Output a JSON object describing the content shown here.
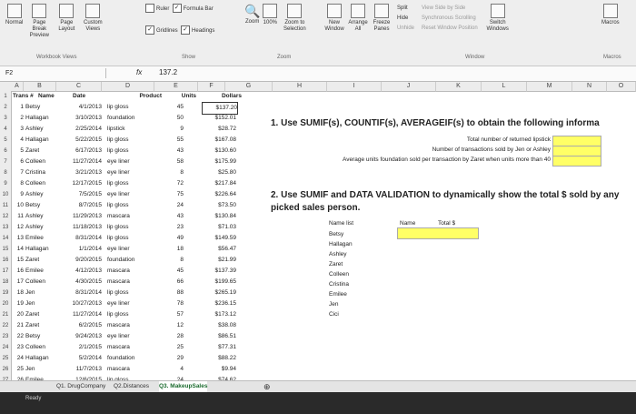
{
  "ribbon": {
    "workbook_views": [
      "Normal",
      "Page Break Preview",
      "Page Layout",
      "Custom Views"
    ],
    "show": {
      "ruler": "Ruler",
      "formula_bar": "Formula Bar",
      "gridlines": "Gridlines",
      "headings": "Headings"
    },
    "zoom": [
      "Zoom",
      "100%",
      "Zoom to Selection"
    ],
    "window": [
      "New Window",
      "Arrange All",
      "Freeze Panes",
      "Split",
      "Hide",
      "Unhide",
      "View Side by Side",
      "Synchronous Scrolling",
      "Reset Window Position",
      "Switch Windows"
    ],
    "macros": "Macros",
    "group_names": [
      "Workbook Views",
      "Show",
      "Zoom",
      "Window",
      "Macros"
    ]
  },
  "formula_bar": {
    "name_box": "F2",
    "fx": "fx",
    "value": "137.2"
  },
  "columns": [
    "A",
    "B",
    "C",
    "D",
    "E",
    "F",
    "G",
    "H",
    "I",
    "J",
    "K",
    "L",
    "M",
    "N",
    "O"
  ],
  "table": {
    "headers": [
      "Trans #",
      "Name",
      "Date",
      "Product",
      "Units",
      "Dollars"
    ],
    "rows": [
      [
        "1",
        "Betsy",
        "4/1/2013",
        "lip gloss",
        "45",
        "$137.20"
      ],
      [
        "2",
        "Hallagan",
        "3/10/2013",
        "foundation",
        "50",
        "$152.01"
      ],
      [
        "3",
        "Ashley",
        "2/25/2014",
        "lipstick",
        "9",
        "$28.72"
      ],
      [
        "4",
        "Hallagan",
        "5/22/2015",
        "lip gloss",
        "55",
        "$167.08"
      ],
      [
        "5",
        "Zaret",
        "6/17/2013",
        "lip gloss",
        "43",
        "$130.60"
      ],
      [
        "6",
        "Colleen",
        "11/27/2014",
        "eye liner",
        "58",
        "$175.99"
      ],
      [
        "7",
        "Cristina",
        "3/21/2013",
        "eye liner",
        "8",
        "$25.80"
      ],
      [
        "8",
        "Colleen",
        "12/17/2015",
        "lip gloss",
        "72",
        "$217.84"
      ],
      [
        "9",
        "Ashley",
        "7/5/2015",
        "eye liner",
        "75",
        "$226.64"
      ],
      [
        "10",
        "Betsy",
        "8/7/2015",
        "lip gloss",
        "24",
        "$73.50"
      ],
      [
        "11",
        "Ashley",
        "11/29/2013",
        "mascara",
        "43",
        "$130.84"
      ],
      [
        "12",
        "Ashley",
        "11/18/2013",
        "lip gloss",
        "23",
        "$71.03"
      ],
      [
        "13",
        "Emilee",
        "8/31/2014",
        "lip gloss",
        "49",
        "$149.59"
      ],
      [
        "14",
        "Hallagan",
        "1/1/2014",
        "eye liner",
        "18",
        "$56.47"
      ],
      [
        "15",
        "Zaret",
        "9/20/2015",
        "foundation",
        "8",
        "$21.99"
      ],
      [
        "16",
        "Emilee",
        "4/12/2013",
        "mascara",
        "45",
        "$137.39"
      ],
      [
        "17",
        "Colleen",
        "4/30/2015",
        "mascara",
        "66",
        "$199.65"
      ],
      [
        "18",
        "Jen",
        "8/31/2014",
        "lip gloss",
        "88",
        "$265.19"
      ],
      [
        "19",
        "Jen",
        "10/27/2013",
        "eye liner",
        "78",
        "$236.15"
      ],
      [
        "20",
        "Zaret",
        "11/27/2014",
        "lip gloss",
        "57",
        "$173.12"
      ],
      [
        "21",
        "Zaret",
        "6/2/2015",
        "mascara",
        "12",
        "$38.08"
      ],
      [
        "22",
        "Betsy",
        "9/24/2013",
        "eye liner",
        "28",
        "$86.51"
      ],
      [
        "23",
        "Colleen",
        "2/1/2015",
        "mascara",
        "25",
        "$77.31"
      ],
      [
        "24",
        "Hallagan",
        "5/2/2014",
        "foundation",
        "29",
        "$88.22"
      ],
      [
        "25",
        "Jen",
        "11/7/2013",
        "mascara",
        "4",
        "$9.94"
      ],
      [
        "26",
        "Emilee",
        "12/6/2015",
        "lip gloss",
        "24",
        "$74.62"
      ]
    ]
  },
  "q1": {
    "title": "1. Use SUMIF(s), COUNTIF(s), AVERAGEIF(s) to obtain the following informa",
    "labels": [
      "Total number of returned lipstick",
      "Number of transactions sold by Jen or Ashley",
      "Average units foundation sold per transaction by Zaret when units more than 40"
    ]
  },
  "q2": {
    "title": "2. Use SUMIF and DATA VALIDATION to dynamically show the total $ sold by any picked sales person.",
    "name_list_header": "Name list",
    "names": [
      "Betsy",
      "Hallagan",
      "Ashley",
      "Zaret",
      "Colleen",
      "Cristina",
      "Emilee",
      "Jen",
      "Cici"
    ],
    "name_header": "Name",
    "total_header": "Total $"
  },
  "tabs": [
    "Q1. DrugCompany",
    "Q2.Distances",
    "Q3. MakeupSales"
  ],
  "status": "Ready",
  "colors": {
    "highlight": "#ffff66",
    "active_tab": "#1b6b2e"
  }
}
